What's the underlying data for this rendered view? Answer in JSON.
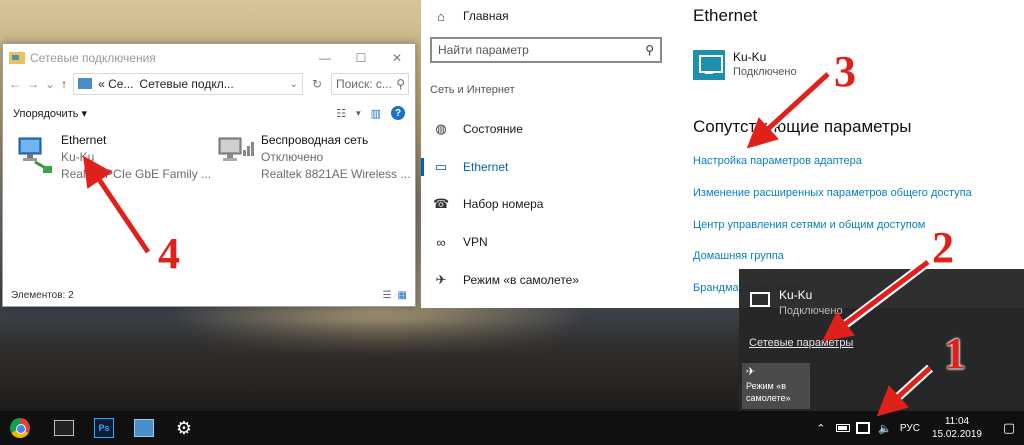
{
  "explorer": {
    "title": "Сетевые подключения",
    "win_min": "—",
    "win_max": "☐",
    "win_close": "✕",
    "nav_back": "←",
    "nav_forward": "→",
    "nav_down": "⌄",
    "nav_up": "↑",
    "path_prefix": "« Се...",
    "path_current": "Сетевые подкл...",
    "path_chevron": "⌄",
    "refresh": "↻",
    "search_placeholder": "Поиск: с...",
    "search_icon": "⚲",
    "organize_label": "Упорядочить ▾",
    "view_icon": "☷",
    "view_chevron": "▾",
    "pane_icon": "▥",
    "help_label": "?",
    "items": [
      {
        "name": "Ethernet",
        "status": "Ku-Ku",
        "device": "Realtek PCIe GbE Family ..."
      },
      {
        "name": "Беспроводная сеть",
        "status": "Отключено",
        "device": "Realtek 8821AE Wireless ..."
      }
    ],
    "status_count": "Элементов: 2",
    "details_view_icon": "☰",
    "large_icons_view_icon": "▦"
  },
  "settings_nav": {
    "home_label": "Главная",
    "home_icon": "⌂",
    "search_placeholder": "Найти параметр",
    "search_icon": "⚲",
    "group_label": "Сеть и Интернет",
    "items": [
      {
        "label": "Состояние",
        "icon": "◍"
      },
      {
        "label": "Ethernet",
        "icon": "▭"
      },
      {
        "label": "Набор номера",
        "icon": "☎"
      },
      {
        "label": "VPN",
        "icon": "∞"
      },
      {
        "label": "Режим «в самолете»",
        "icon": "✈"
      }
    ],
    "active_index": 1
  },
  "settings_content": {
    "title": "Ethernet",
    "connection_name": "Ku-Ku",
    "connection_status": "Подключено",
    "related_title": "Сопутствующие параметры",
    "links": [
      "Настройка параметров адаптера",
      "Изменение расширенных параметров общего доступа",
      "Центр управления сетями и общим доступом",
      "Домашняя группа",
      "Брандмауэр Windows"
    ]
  },
  "flyout": {
    "connection_name": "Ku-Ku",
    "connection_status": "Подключено",
    "network_settings_link": "Сетевые параметры",
    "airplane_icon": "✈",
    "airplane_label": "Режим «в самолете»"
  },
  "taskbar": {
    "apps": [
      "chrome-icon",
      "cmd-icon",
      "photoshop-icon",
      "network-connections-icon",
      "settings-gear-icon"
    ],
    "ps_label": "Ps",
    "gear_glyph": "⚙",
    "tray_chevron": "⌃",
    "volume_icon": "🔈",
    "language": "РУС",
    "time": "11:04",
    "date": "15.02.2019",
    "notifications_icon": "▢"
  },
  "annotations": [
    "1",
    "2",
    "3",
    "4"
  ],
  "colors": {
    "accent": "#0063b1",
    "link": "#0a7fbf",
    "annotation_red": "#e0201a"
  }
}
